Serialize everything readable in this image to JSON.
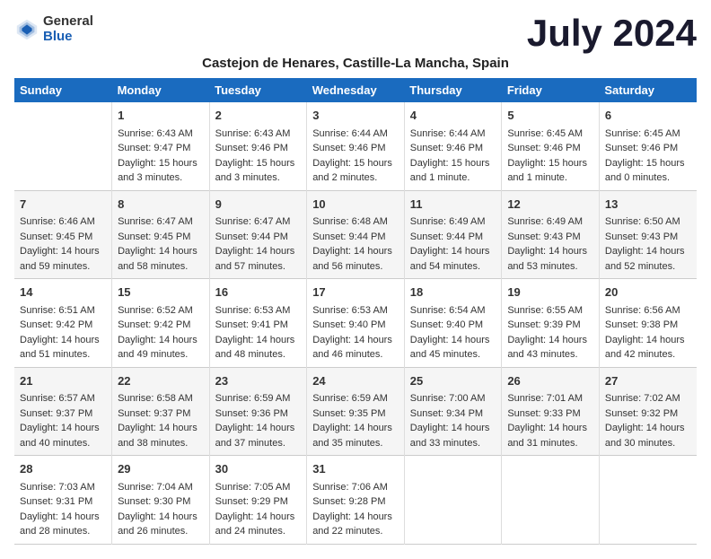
{
  "logo": {
    "text_general": "General",
    "text_blue": "Blue"
  },
  "month_title": "July 2024",
  "location": "Castejon de Henares, Castille-La Mancha, Spain",
  "days_header": [
    "Sunday",
    "Monday",
    "Tuesday",
    "Wednesday",
    "Thursday",
    "Friday",
    "Saturday"
  ],
  "weeks": [
    [
      {
        "day": "",
        "sunrise": "",
        "sunset": "",
        "daylight": ""
      },
      {
        "day": "1",
        "sunrise": "Sunrise: 6:43 AM",
        "sunset": "Sunset: 9:47 PM",
        "daylight": "Daylight: 15 hours and 3 minutes."
      },
      {
        "day": "2",
        "sunrise": "Sunrise: 6:43 AM",
        "sunset": "Sunset: 9:46 PM",
        "daylight": "Daylight: 15 hours and 3 minutes."
      },
      {
        "day": "3",
        "sunrise": "Sunrise: 6:44 AM",
        "sunset": "Sunset: 9:46 PM",
        "daylight": "Daylight: 15 hours and 2 minutes."
      },
      {
        "day": "4",
        "sunrise": "Sunrise: 6:44 AM",
        "sunset": "Sunset: 9:46 PM",
        "daylight": "Daylight: 15 hours and 1 minute."
      },
      {
        "day": "5",
        "sunrise": "Sunrise: 6:45 AM",
        "sunset": "Sunset: 9:46 PM",
        "daylight": "Daylight: 15 hours and 1 minute."
      },
      {
        "day": "6",
        "sunrise": "Sunrise: 6:45 AM",
        "sunset": "Sunset: 9:46 PM",
        "daylight": "Daylight: 15 hours and 0 minutes."
      }
    ],
    [
      {
        "day": "7",
        "sunrise": "Sunrise: 6:46 AM",
        "sunset": "Sunset: 9:45 PM",
        "daylight": "Daylight: 14 hours and 59 minutes."
      },
      {
        "day": "8",
        "sunrise": "Sunrise: 6:47 AM",
        "sunset": "Sunset: 9:45 PM",
        "daylight": "Daylight: 14 hours and 58 minutes."
      },
      {
        "day": "9",
        "sunrise": "Sunrise: 6:47 AM",
        "sunset": "Sunset: 9:44 PM",
        "daylight": "Daylight: 14 hours and 57 minutes."
      },
      {
        "day": "10",
        "sunrise": "Sunrise: 6:48 AM",
        "sunset": "Sunset: 9:44 PM",
        "daylight": "Daylight: 14 hours and 56 minutes."
      },
      {
        "day": "11",
        "sunrise": "Sunrise: 6:49 AM",
        "sunset": "Sunset: 9:44 PM",
        "daylight": "Daylight: 14 hours and 54 minutes."
      },
      {
        "day": "12",
        "sunrise": "Sunrise: 6:49 AM",
        "sunset": "Sunset: 9:43 PM",
        "daylight": "Daylight: 14 hours and 53 minutes."
      },
      {
        "day": "13",
        "sunrise": "Sunrise: 6:50 AM",
        "sunset": "Sunset: 9:43 PM",
        "daylight": "Daylight: 14 hours and 52 minutes."
      }
    ],
    [
      {
        "day": "14",
        "sunrise": "Sunrise: 6:51 AM",
        "sunset": "Sunset: 9:42 PM",
        "daylight": "Daylight: 14 hours and 51 minutes."
      },
      {
        "day": "15",
        "sunrise": "Sunrise: 6:52 AM",
        "sunset": "Sunset: 9:42 PM",
        "daylight": "Daylight: 14 hours and 49 minutes."
      },
      {
        "day": "16",
        "sunrise": "Sunrise: 6:53 AM",
        "sunset": "Sunset: 9:41 PM",
        "daylight": "Daylight: 14 hours and 48 minutes."
      },
      {
        "day": "17",
        "sunrise": "Sunrise: 6:53 AM",
        "sunset": "Sunset: 9:40 PM",
        "daylight": "Daylight: 14 hours and 46 minutes."
      },
      {
        "day": "18",
        "sunrise": "Sunrise: 6:54 AM",
        "sunset": "Sunset: 9:40 PM",
        "daylight": "Daylight: 14 hours and 45 minutes."
      },
      {
        "day": "19",
        "sunrise": "Sunrise: 6:55 AM",
        "sunset": "Sunset: 9:39 PM",
        "daylight": "Daylight: 14 hours and 43 minutes."
      },
      {
        "day": "20",
        "sunrise": "Sunrise: 6:56 AM",
        "sunset": "Sunset: 9:38 PM",
        "daylight": "Daylight: 14 hours and 42 minutes."
      }
    ],
    [
      {
        "day": "21",
        "sunrise": "Sunrise: 6:57 AM",
        "sunset": "Sunset: 9:37 PM",
        "daylight": "Daylight: 14 hours and 40 minutes."
      },
      {
        "day": "22",
        "sunrise": "Sunrise: 6:58 AM",
        "sunset": "Sunset: 9:37 PM",
        "daylight": "Daylight: 14 hours and 38 minutes."
      },
      {
        "day": "23",
        "sunrise": "Sunrise: 6:59 AM",
        "sunset": "Sunset: 9:36 PM",
        "daylight": "Daylight: 14 hours and 37 minutes."
      },
      {
        "day": "24",
        "sunrise": "Sunrise: 6:59 AM",
        "sunset": "Sunset: 9:35 PM",
        "daylight": "Daylight: 14 hours and 35 minutes."
      },
      {
        "day": "25",
        "sunrise": "Sunrise: 7:00 AM",
        "sunset": "Sunset: 9:34 PM",
        "daylight": "Daylight: 14 hours and 33 minutes."
      },
      {
        "day": "26",
        "sunrise": "Sunrise: 7:01 AM",
        "sunset": "Sunset: 9:33 PM",
        "daylight": "Daylight: 14 hours and 31 minutes."
      },
      {
        "day": "27",
        "sunrise": "Sunrise: 7:02 AM",
        "sunset": "Sunset: 9:32 PM",
        "daylight": "Daylight: 14 hours and 30 minutes."
      }
    ],
    [
      {
        "day": "28",
        "sunrise": "Sunrise: 7:03 AM",
        "sunset": "Sunset: 9:31 PM",
        "daylight": "Daylight: 14 hours and 28 minutes."
      },
      {
        "day": "29",
        "sunrise": "Sunrise: 7:04 AM",
        "sunset": "Sunset: 9:30 PM",
        "daylight": "Daylight: 14 hours and 26 minutes."
      },
      {
        "day": "30",
        "sunrise": "Sunrise: 7:05 AM",
        "sunset": "Sunset: 9:29 PM",
        "daylight": "Daylight: 14 hours and 24 minutes."
      },
      {
        "day": "31",
        "sunrise": "Sunrise: 7:06 AM",
        "sunset": "Sunset: 9:28 PM",
        "daylight": "Daylight: 14 hours and 22 minutes."
      },
      {
        "day": "",
        "sunrise": "",
        "sunset": "",
        "daylight": ""
      },
      {
        "day": "",
        "sunrise": "",
        "sunset": "",
        "daylight": ""
      },
      {
        "day": "",
        "sunrise": "",
        "sunset": "",
        "daylight": ""
      }
    ]
  ]
}
